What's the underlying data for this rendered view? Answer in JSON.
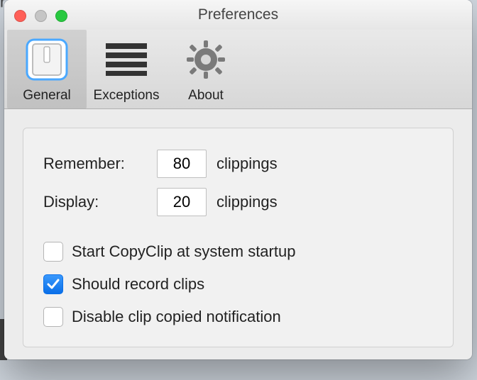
{
  "window": {
    "title": "Preferences"
  },
  "toolbar": {
    "items": [
      {
        "label": "General"
      },
      {
        "label": "Exceptions"
      },
      {
        "label": "About"
      }
    ]
  },
  "settings": {
    "remember": {
      "label": "Remember:",
      "value": "80",
      "suffix": "clippings"
    },
    "display": {
      "label": "Display:",
      "value": "20",
      "suffix": "clippings"
    },
    "start_at_login": {
      "label": "Start CopyClip at system startup",
      "checked": false
    },
    "record_clips": {
      "label": "Should record clips",
      "checked": true
    },
    "disable_notif": {
      "label": "Disable clip copied notification",
      "checked": false
    }
  }
}
